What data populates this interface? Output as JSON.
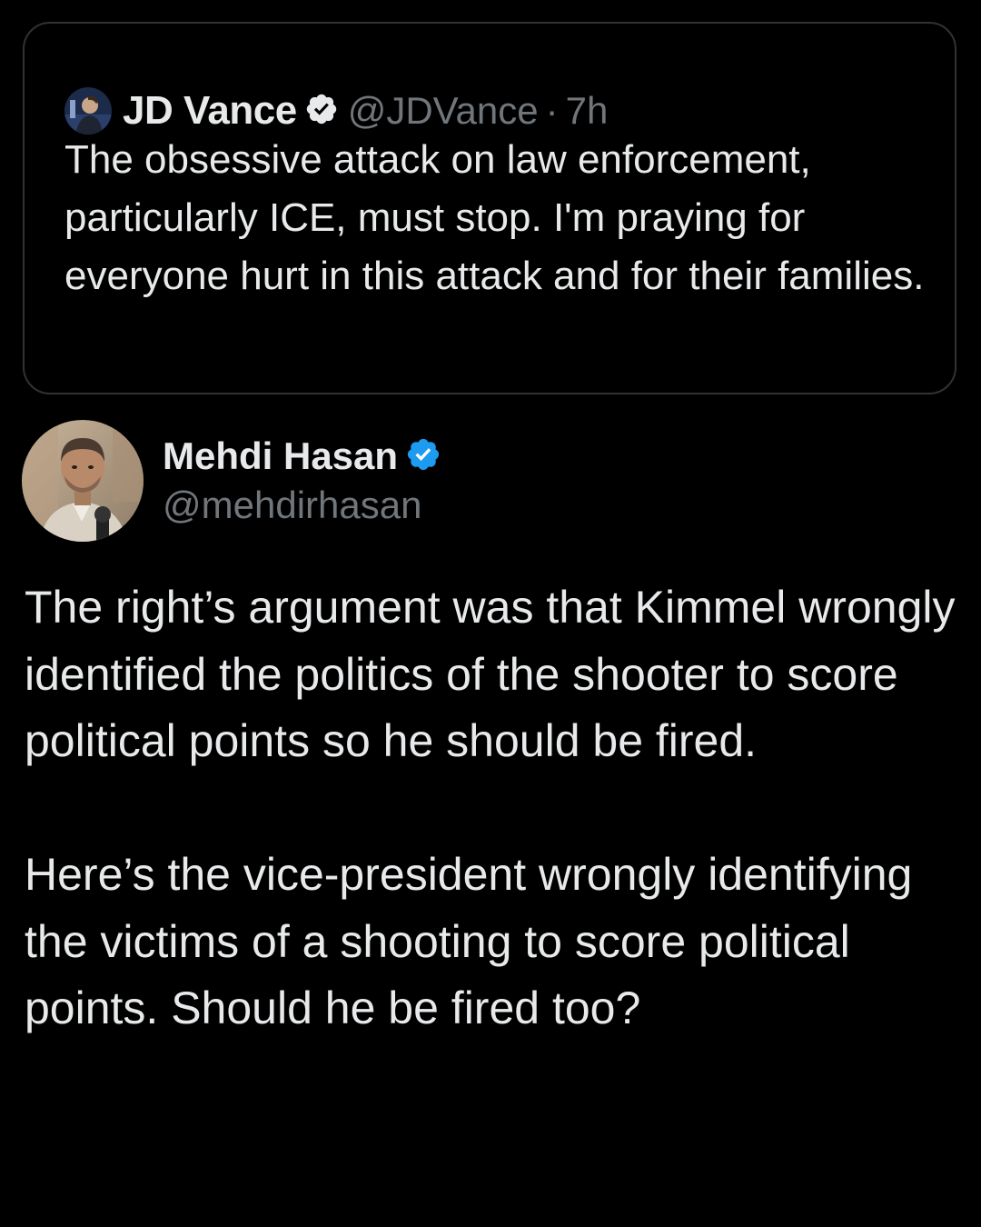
{
  "quoted_tweet": {
    "author_name": "JD Vance",
    "handle": "@JDVance",
    "separator": "·",
    "time": "7h",
    "text": "The obsessive attack on law enforcement, particularly ICE, must stop. I'm praying for everyone hurt in this attack and for their families.",
    "verified_icon": "verified-badge-icon",
    "avatar_icon": "avatar-photo"
  },
  "main_tweet": {
    "author_name": "Mehdi Hasan",
    "handle": "@mehdirhasan",
    "verified_icon": "verified-badge-icon",
    "avatar_icon": "avatar-photo",
    "paragraphs": [
      "The right’s argument was that Kimmel wrongly identified the politics of the shooter to score political points so he should be fired.",
      "Here’s the vice-president wrongly identifying the victims of a shooting to score political points. Should he be fired too?"
    ]
  },
  "colors": {
    "background": "#000000",
    "primary_text": "#e7e9ea",
    "secondary_text": "#71767b",
    "border": "#2f3336",
    "verified_blue": "#1d9bf0"
  }
}
